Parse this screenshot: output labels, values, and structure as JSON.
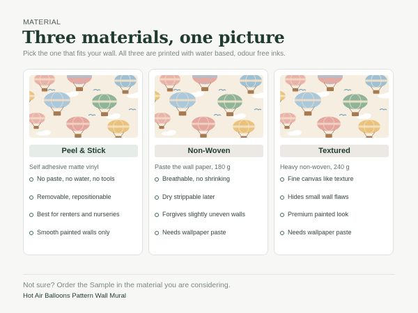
{
  "eyebrow": "MATERIAL",
  "title": "Three materials, one picture",
  "subtitle": "Pick the one that fits your wall. All three are printed with water based, odour free inks.",
  "colors": {
    "background": "#f7f8f6",
    "title": "#1f3a30",
    "selected_pill": "#e6ede9",
    "pill": "#ece8e3",
    "bullet": "#3f6b55"
  },
  "cards": [
    {
      "name": "Peel & Stick",
      "selected": true,
      "description": "Self adhesive matte vinyl",
      "features": [
        "No paste, no water, no tools",
        "Removable, repositionable",
        "Best for renters and nurseries",
        "Smooth painted walls only"
      ]
    },
    {
      "name": "Non-Woven",
      "selected": false,
      "description": "Paste the wall paper, 180 g",
      "features": [
        "Breathable, no shrinking",
        "Dry strippable later",
        "Forgives slightly uneven walls",
        "Needs wallpaper paste"
      ]
    },
    {
      "name": "Textured",
      "selected": false,
      "description": "Heavy non-woven, 240 g",
      "features": [
        "Fine canvas like texture",
        "Hides small wall flaws",
        "Premium painted look",
        "Needs wallpaper paste"
      ]
    }
  ],
  "footer": {
    "note": "Not sure? Order the Sample in the material you are considering.",
    "product_name": "Hot Air Balloons Pattern Wall Mural"
  },
  "thumbnail_icon": "hot-air-balloon-pattern"
}
